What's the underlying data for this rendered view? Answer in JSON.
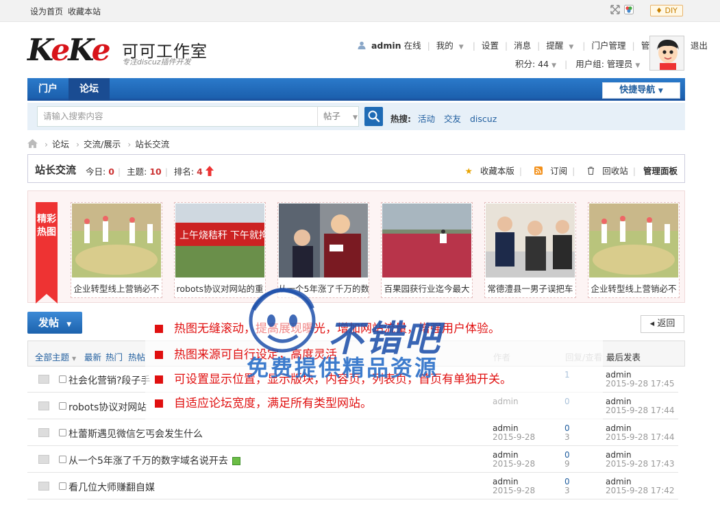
{
  "topbar": {
    "set_home": "设为首页",
    "bookmark": "收藏本站",
    "diy": "DIY"
  },
  "logo": {
    "brand": "KeKe",
    "name": "可可工作室",
    "slogan": "专注discuz插件开发"
  },
  "user": {
    "name": "admin",
    "status": "在线",
    "mine": "我的",
    "settings": "设置",
    "messages": "消息",
    "remind": "提醒",
    "portal_admin": "门户管理",
    "admin_center": "管理中心",
    "logout": "退出",
    "points": "积分: 44",
    "group": "用户组: 管理员"
  },
  "nav": {
    "tabs": [
      "门户",
      "论坛"
    ],
    "active": "论坛",
    "quick_nav": "快捷导航"
  },
  "search": {
    "placeholder": "请输入搜索内容",
    "type": "帖子",
    "hot_label": "热搜:",
    "hot": [
      "活动",
      "交友",
      "discuz"
    ]
  },
  "breadcrumb": [
    "论坛",
    "交流/展示",
    "站长交流"
  ],
  "forum": {
    "title": "站长交流",
    "today_label": "今日:",
    "today": "0",
    "topics_label": "主题:",
    "topics": "10",
    "rank_label": "排名:",
    "rank": "4",
    "actions": {
      "favorite": "收藏本版",
      "subscribe": "订阅",
      "recycle": "回收站",
      "admin_panel": "管理面板"
    }
  },
  "hotpic": {
    "tag": "精彩热图",
    "items": [
      {
        "caption": "企业转型线上营销必不"
      },
      {
        "caption": "robots协议对网站的重"
      },
      {
        "caption": "从一个5年涨了千万的数"
      },
      {
        "caption": "百果园获行业迄今最大"
      },
      {
        "caption": "常德澧县一男子误把车"
      },
      {
        "caption": "企业转型线上营销必不"
      }
    ]
  },
  "toolbar": {
    "post": "发帖",
    "back": "返回"
  },
  "list": {
    "filters": [
      "全部主题",
      "最新",
      "热门",
      "热帖"
    ],
    "col_author": "作者",
    "col_replies": "回复/查看",
    "col_last": "最后发表",
    "rows": [
      {
        "title": "社会化营销?段子手",
        "author": "",
        "date": "",
        "replies": "1",
        "views": "",
        "last_user": "admin",
        "last_time": "2015-9-28 17:45",
        "img": false
      },
      {
        "title": "robots协议对网站",
        "author": "admin",
        "date": "",
        "replies": "0",
        "views": "",
        "last_user": "admin",
        "last_time": "2015-9-28 17:44",
        "img": true
      },
      {
        "title": "杜蕾斯遇见微信乞丐会发生什么",
        "author": "admin",
        "date": "2015-9-28",
        "replies": "0",
        "views": "3",
        "last_user": "admin",
        "last_time": "2015-9-28 17:44",
        "img": false
      },
      {
        "title": "从一个5年涨了千万的数字域名说开去",
        "author": "admin",
        "date": "2015-9-28",
        "replies": "0",
        "views": "9",
        "last_user": "admin",
        "last_time": "2015-9-28 17:43",
        "img": true
      },
      {
        "title": "看几位大师赚翻自媒",
        "author": "admin",
        "date": "2015-9-28",
        "replies": "0",
        "views": "3",
        "last_user": "admin",
        "last_time": "2015-9-28 17:42",
        "img": false
      }
    ]
  },
  "overlay": {
    "features": [
      "热图无缝滚动，提高展现曝光，增加网站流量，增强用户体验。",
      "热图来源可自行设定，高度灵活",
      "可设置显示位置，显示版块，内容页，列表页，首页有单独开关。",
      "自适应论坛宽度，满足所有类型网站。"
    ],
    "watermark1": "不错吧",
    "watermark2": "免费提供精品资源"
  }
}
